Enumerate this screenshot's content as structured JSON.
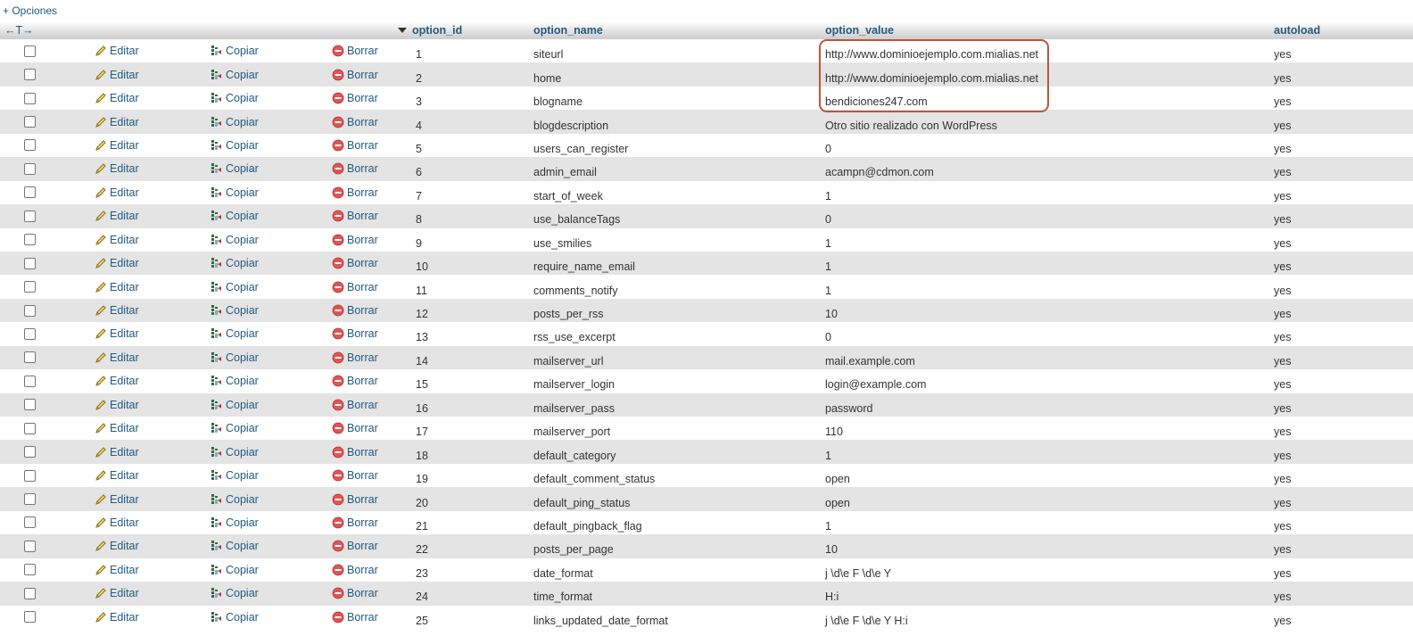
{
  "top": {
    "options_link": "+ Opciones",
    "column_arrows": "←T→"
  },
  "header": {
    "option_id": "option_id",
    "option_name": "option_name",
    "option_value": "option_value",
    "autoload": "autoload"
  },
  "actions": {
    "edit_label": "Editar",
    "copy_label": "Copiar",
    "delete_label": "Borrar"
  },
  "icons": {
    "edit": "pencil-icon",
    "copy": "copy-icon",
    "delete": "delete-icon",
    "sort": "sort-desc-icon"
  },
  "colors": {
    "link": "#235a81",
    "row_alt": "#e4e4e4",
    "highlight": "#c0543a"
  },
  "rows": [
    {
      "id": "1",
      "name": "siteurl",
      "value": "http://www.dominioejemplo.com.mialias.net",
      "autoload": "yes"
    },
    {
      "id": "2",
      "name": "home",
      "value": "http://www.dominioejemplo.com.mialias.net",
      "autoload": "yes"
    },
    {
      "id": "3",
      "name": "blogname",
      "value": "bendiciones247.com",
      "autoload": "yes"
    },
    {
      "id": "4",
      "name": "blogdescription",
      "value": "Otro sitio realizado con WordPress",
      "autoload": "yes"
    },
    {
      "id": "5",
      "name": "users_can_register",
      "value": "0",
      "autoload": "yes"
    },
    {
      "id": "6",
      "name": "admin_email",
      "value": "acampn@cdmon.com",
      "autoload": "yes"
    },
    {
      "id": "7",
      "name": "start_of_week",
      "value": "1",
      "autoload": "yes"
    },
    {
      "id": "8",
      "name": "use_balanceTags",
      "value": "0",
      "autoload": "yes"
    },
    {
      "id": "9",
      "name": "use_smilies",
      "value": "1",
      "autoload": "yes"
    },
    {
      "id": "10",
      "name": "require_name_email",
      "value": "1",
      "autoload": "yes"
    },
    {
      "id": "11",
      "name": "comments_notify",
      "value": "1",
      "autoload": "yes"
    },
    {
      "id": "12",
      "name": "posts_per_rss",
      "value": "10",
      "autoload": "yes"
    },
    {
      "id": "13",
      "name": "rss_use_excerpt",
      "value": "0",
      "autoload": "yes"
    },
    {
      "id": "14",
      "name": "mailserver_url",
      "value": "mail.example.com",
      "autoload": "yes"
    },
    {
      "id": "15",
      "name": "mailserver_login",
      "value": "login@example.com",
      "autoload": "yes"
    },
    {
      "id": "16",
      "name": "mailserver_pass",
      "value": "password",
      "autoload": "yes"
    },
    {
      "id": "17",
      "name": "mailserver_port",
      "value": "110",
      "autoload": "yes"
    },
    {
      "id": "18",
      "name": "default_category",
      "value": "1",
      "autoload": "yes"
    },
    {
      "id": "19",
      "name": "default_comment_status",
      "value": "open",
      "autoload": "yes"
    },
    {
      "id": "20",
      "name": "default_ping_status",
      "value": "open",
      "autoload": "yes"
    },
    {
      "id": "21",
      "name": "default_pingback_flag",
      "value": "1",
      "autoload": "yes"
    },
    {
      "id": "22",
      "name": "posts_per_page",
      "value": "10",
      "autoload": "yes"
    },
    {
      "id": "23",
      "name": "date_format",
      "value": "j \\d\\e F \\d\\e Y",
      "autoload": "yes"
    },
    {
      "id": "24",
      "name": "time_format",
      "value": "H:i",
      "autoload": "yes"
    },
    {
      "id": "25",
      "name": "links_updated_date_format",
      "value": "j \\d\\e F \\d\\e Y H:i",
      "autoload": "yes"
    }
  ]
}
